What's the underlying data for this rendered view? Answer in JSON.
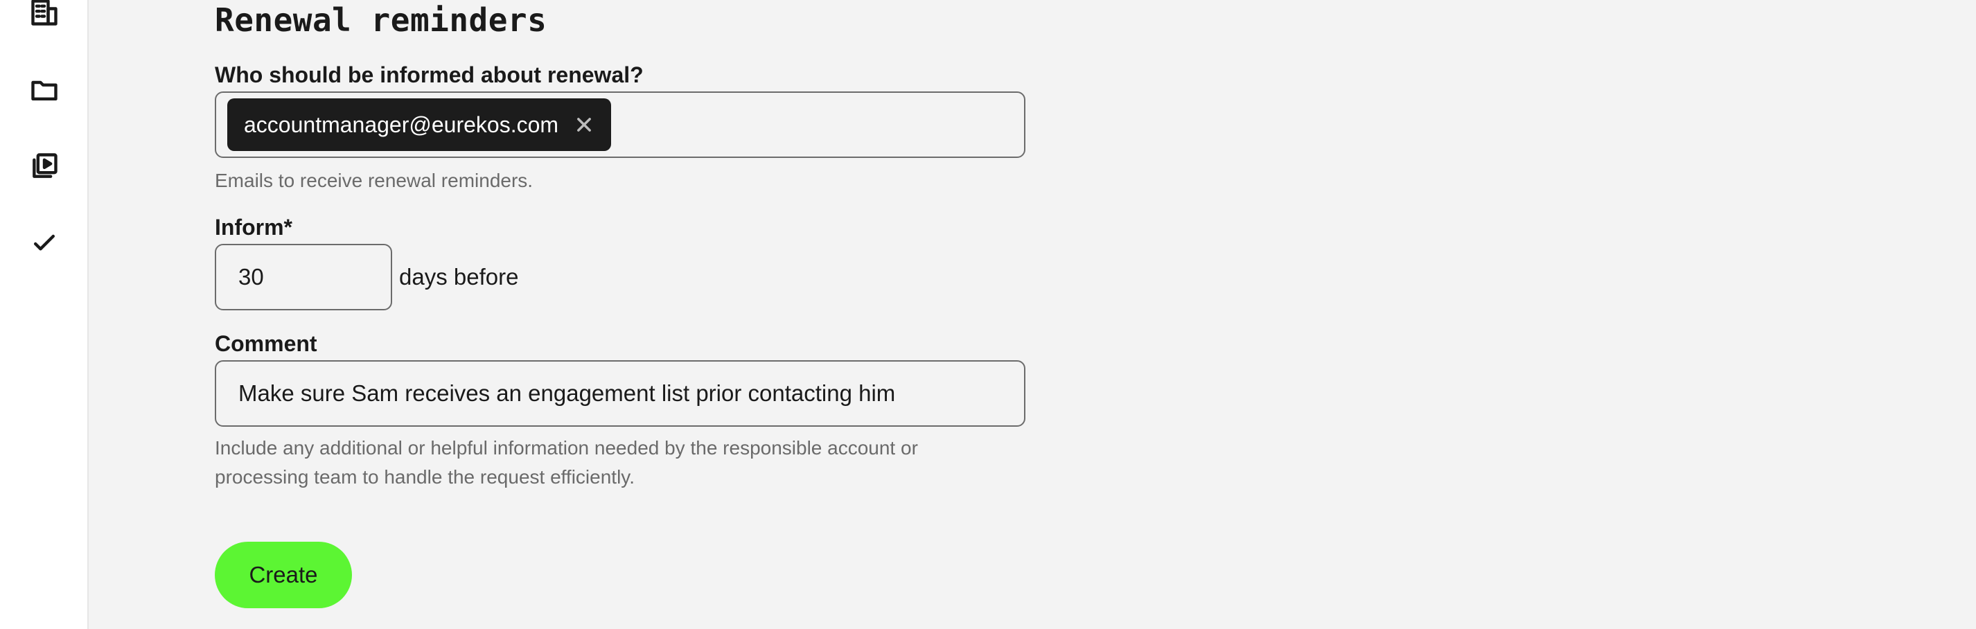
{
  "sidebar": {
    "icons": [
      "building-icon",
      "folder-icon",
      "video-library-icon",
      "check-icon"
    ]
  },
  "main": {
    "title": "Renewal reminders",
    "recipients": {
      "label": "Who should be informed about renewal?",
      "chips": [
        "accountmanager@eurekos.com"
      ],
      "help": "Emails to receive renewal reminders."
    },
    "inform": {
      "label": "Inform*",
      "value": "30",
      "suffix": "days before"
    },
    "comment": {
      "label": "Comment",
      "value": "Make sure Sam receives an engagement list prior contacting him",
      "help_line1": "Include any additional or helpful information needed by the responsible account or",
      "help_line2": "processing team to handle the request efficiently."
    },
    "create_label": "Create"
  },
  "colors": {
    "accent": "#5cf533",
    "chip_bg": "#1c1c1c",
    "page_bg": "#f3f3f3"
  }
}
